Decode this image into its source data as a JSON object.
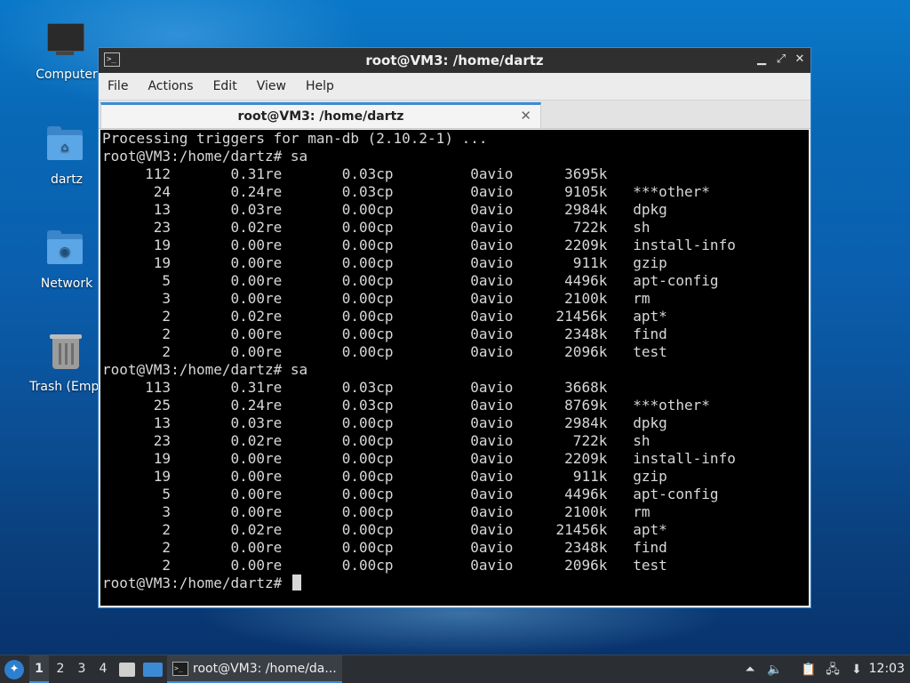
{
  "desktop": {
    "icons": [
      {
        "label": "Computer",
        "icon": "computer-icon"
      },
      {
        "label": "dartz",
        "icon": "home-folder-icon"
      },
      {
        "label": "Network",
        "icon": "network-folder-icon"
      },
      {
        "label": "Trash (Empt",
        "icon": "trash-icon"
      }
    ]
  },
  "window": {
    "title": "root@VM3: /home/dartz",
    "controls": {
      "minimize": "▁",
      "maximize": "⤢",
      "close": "✕"
    },
    "menu": [
      "File",
      "Actions",
      "Edit",
      "View",
      "Help"
    ],
    "tab": {
      "label": "root@VM3: /home/dartz",
      "close": "✕"
    },
    "accent": "#3d8ad4"
  },
  "terminal": {
    "lines": [
      "Processing triggers for man-db (2.10.2-1) ...",
      "root@VM3:/home/dartz# sa",
      "     112       0.31re       0.03cp         0avio      3695k",
      "      24       0.24re       0.03cp         0avio      9105k   ***other*",
      "      13       0.03re       0.00cp         0avio      2984k   dpkg",
      "      23       0.02re       0.00cp         0avio       722k   sh",
      "      19       0.00re       0.00cp         0avio      2209k   install-info",
      "      19       0.00re       0.00cp         0avio       911k   gzip",
      "       5       0.00re       0.00cp         0avio      4496k   apt-config",
      "       3       0.00re       0.00cp         0avio      2100k   rm",
      "       2       0.02re       0.00cp         0avio     21456k   apt*",
      "       2       0.00re       0.00cp         0avio      2348k   find",
      "       2       0.00re       0.00cp         0avio      2096k   test",
      "root@VM3:/home/dartz# sa",
      "     113       0.31re       0.03cp         0avio      3668k",
      "      25       0.24re       0.03cp         0avio      8769k   ***other*",
      "      13       0.03re       0.00cp         0avio      2984k   dpkg",
      "      23       0.02re       0.00cp         0avio       722k   sh",
      "      19       0.00re       0.00cp         0avio      2209k   install-info",
      "      19       0.00re       0.00cp         0avio       911k   gzip",
      "       5       0.00re       0.00cp         0avio      4496k   apt-config",
      "       3       0.00re       0.00cp         0avio      2100k   rm",
      "       2       0.02re       0.00cp         0avio     21456k   apt*",
      "       2       0.00re       0.00cp         0avio      2348k   find",
      "       2       0.00re       0.00cp         0avio      2096k   test"
    ],
    "prompt": "root@VM3:/home/dartz# "
  },
  "taskbar": {
    "workspaces": [
      "1",
      "2",
      "3",
      "4"
    ],
    "active_workspace": "1",
    "task_label": "root@VM3: /home/da...",
    "clock": "12:03"
  }
}
